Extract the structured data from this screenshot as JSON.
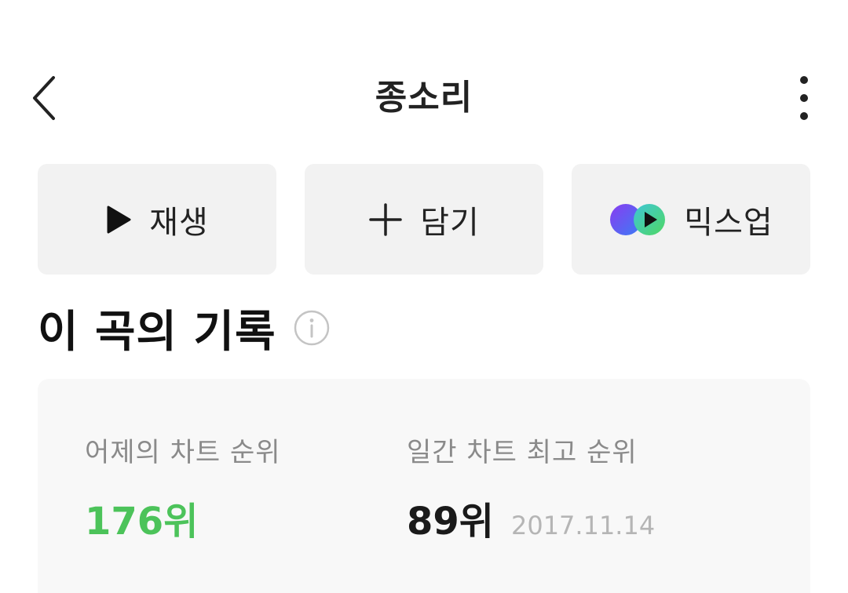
{
  "header": {
    "title": "종소리",
    "back_icon": "chevron-left-icon",
    "more_icon": "more-vertical-icon"
  },
  "actions": [
    {
      "label": "재생",
      "icon": "play-icon"
    },
    {
      "label": "담기",
      "icon": "plus-icon"
    },
    {
      "label": "믹스업",
      "icon": "mixup-icon"
    }
  ],
  "section": {
    "title": "이 곡의 기록",
    "info_icon": "info-icon"
  },
  "stats": {
    "yesterday_label": "어제의 차트 순위",
    "yesterday_value": "176위",
    "best_label": "일간 차트 최고 순위",
    "best_value": "89위",
    "best_date": "2017.11.14"
  },
  "colors": {
    "accent_green": "#4cc35a",
    "button_bg": "#f2f2f2",
    "card_bg": "#f8f8f8",
    "text_primary": "#222222",
    "text_secondary": "#8a8a8a",
    "text_muted": "#b5b5b5"
  }
}
